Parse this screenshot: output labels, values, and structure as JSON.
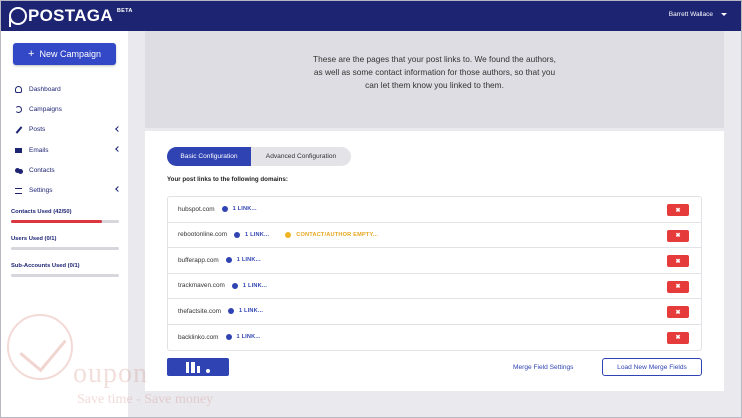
{
  "app": {
    "name": "POSTAGA",
    "badge": "BETA"
  },
  "header": {
    "user_name": "Barrett Wallace"
  },
  "sidebar": {
    "new_campaign_label": "New Campaign",
    "items": [
      {
        "label": "Dashboard",
        "icon": "dashboard-icon",
        "has_chevron": false
      },
      {
        "label": "Campaigns",
        "icon": "refresh-icon",
        "has_chevron": false
      },
      {
        "label": "Posts",
        "icon": "pencil-icon",
        "has_chevron": true
      },
      {
        "label": "Emails",
        "icon": "envelope-icon",
        "has_chevron": true
      },
      {
        "label": "Contacts",
        "icon": "users-icon",
        "has_chevron": false
      },
      {
        "label": "Settings",
        "icon": "sliders-icon",
        "has_chevron": true
      }
    ],
    "stats": [
      {
        "label": "Contacts Used (42/50)",
        "fraction": 0.84
      },
      {
        "label": "Users Used (0/1)",
        "fraction": 0
      },
      {
        "label": "Sub-Accounts Used (0/1)",
        "fraction": 0
      }
    ]
  },
  "info": {
    "lines": [
      "These are the pages that your post links to. We found the authors,",
      "as well as some contact information for those authors, so that you",
      "can let them know you linked to them."
    ]
  },
  "tabs": {
    "basic": "Basic Configuration",
    "advanced": "Advanced Configuration"
  },
  "domains_heading": "Your post links to the following domains:",
  "domains": [
    {
      "domain": "hubspot.com",
      "links": "1 LINK...",
      "warning": ""
    },
    {
      "domain": "rebootonline.com",
      "links": "1 LINK...",
      "warning": "CONTACT/AUTHOR EMPTY..."
    },
    {
      "domain": "bufferapp.com",
      "links": "1 LINK...",
      "warning": ""
    },
    {
      "domain": "trackmaven.com",
      "links": "1 LINK...",
      "warning": ""
    },
    {
      "domain": "thefactsite.com",
      "links": "1 LINK...",
      "warning": ""
    },
    {
      "domain": "backlinko.com",
      "links": "1 LINK...",
      "warning": ""
    }
  ],
  "delete_label": "✖",
  "footer": {
    "merge_settings": "Merge Field Settings",
    "load_fields": "Load New Merge Fields"
  },
  "watermark": {
    "word": "oupon",
    "tagline": "Save time - Save money"
  },
  "colors": {
    "header": "#1d2472",
    "primary": "#2f43b3",
    "danger": "#e63b3b",
    "warning": "#f0b323"
  }
}
